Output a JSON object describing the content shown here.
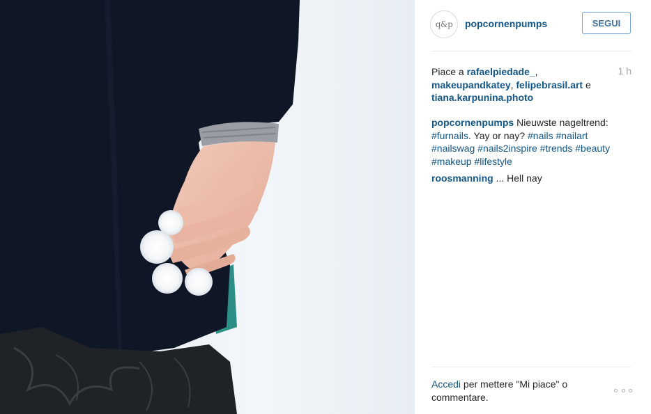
{
  "post": {
    "username": "popcornenpumps",
    "follow_label": "SEGUI",
    "avatar_text": "q&p",
    "time": "1 h"
  },
  "likes": {
    "prefix": "Piace a ",
    "users": [
      "rafaelpiedade_",
      "makeupandkatey",
      "felipebrasil.art",
      "tiana.karpunina.photo"
    ],
    "sep1": ",",
    "sep2": ", ",
    "conj": " e"
  },
  "caption": {
    "author": "popcornenpumps",
    "text": " Nieuwste nageltrend: ",
    "tag1": "#furnails",
    "text2": ". Yay or nay? ",
    "tags": [
      "#nails",
      "#nailart",
      "#nailswag",
      "#nails2inspire",
      "#trends",
      "#beauty",
      "#makeup",
      "#lifestyle"
    ]
  },
  "comment": {
    "author": "roosmanning",
    "text": " ... Hell nay"
  },
  "footer": {
    "login_link": "Accedi",
    "text": " per mettere \"Mi piace\" o commentare."
  },
  "icons": {
    "more": "more-options-icon"
  },
  "colors": {
    "link": "#125688",
    "follow_border": "#70a4d6",
    "muted": "#a5a7aa"
  }
}
